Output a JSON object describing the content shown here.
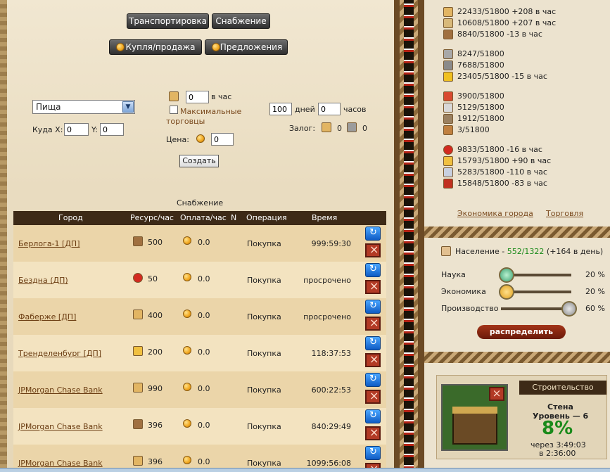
{
  "tabs": {
    "transport": "Транспортировка",
    "supply": "Снабжение",
    "trade": "Купля/продажа",
    "offers": "Предложения"
  },
  "form": {
    "resource_selected": "Пища",
    "per_hour_value": "0",
    "per_hour_label": "в час",
    "max_trade_label_1": "Максимальные",
    "max_trade_label_2": "торговцы",
    "days_value": "100",
    "days_label": "дней",
    "hours_value": "0",
    "hours_label": "часов",
    "dest_label": "Куда X:",
    "x_value": "0",
    "y_label": "Y:",
    "y_value": "0",
    "price_label": "Цена:",
    "price_value": "0",
    "collateral_label": "Залог:",
    "collateral_1": "0",
    "collateral_2": "0",
    "create_button": "Создать"
  },
  "table": {
    "title": "Снабжение",
    "headers": {
      "city": "Город",
      "resource": "Ресурс/час",
      "pay": "Оплата/час",
      "n": "N",
      "operation": "Операция",
      "time": "Время"
    },
    "rows": [
      {
        "city": "Берлога-1 [ДП]",
        "res_icon": "wood-icon",
        "res": "500",
        "pay": "0.0",
        "op": "Покупка",
        "time": "999:59:30"
      },
      {
        "city": "Бездна (ДП)",
        "res_icon": "apple-icon",
        "res": "50",
        "pay": "0.0",
        "op": "Покупка",
        "time": "просрочено"
      },
      {
        "city": "Фаберже [ДП]",
        "res_icon": "food-icon",
        "res": "400",
        "pay": "0.0",
        "op": "Покупка",
        "time": "просрочено"
      },
      {
        "city": "Тренделенбург [ДП]",
        "res_icon": "horn-icon",
        "res": "200",
        "pay": "0.0",
        "op": "Покупка",
        "time": "118:37:53"
      },
      {
        "city": "JPMorgan Chase Bank",
        "res_icon": "food-icon",
        "res": "990",
        "pay": "0.0",
        "op": "Покупка",
        "time": "600:22:53"
      },
      {
        "city": "JPMorgan Chase Bank",
        "res_icon": "wood-icon",
        "res": "396",
        "pay": "0.0",
        "op": "Покупка",
        "time": "840:29:49"
      },
      {
        "city": "JPMorgan Chase Bank",
        "res_icon": "food-icon",
        "res": "396",
        "pay": "0.0",
        "op": "Покупка",
        "time": "1099:56:08"
      }
    ]
  },
  "resources": [
    {
      "icon": "food-icon",
      "text": "22433/51800 +208 в час"
    },
    {
      "icon": "grain-icon",
      "text": "10608/51800 +207 в час"
    },
    {
      "icon": "wood-icon",
      "text": "8840/51800 -13 в час"
    },
    {
      "icon": "stone-icon",
      "text": "8247/51800"
    },
    {
      "icon": "tool-icon",
      "text": "7688/51800"
    },
    {
      "icon": "gold-icon",
      "text": "23405/51800 -15 в час"
    },
    {
      "icon": "potion-icon",
      "text": "3900/51800"
    },
    {
      "icon": "cloth-icon",
      "text": "5129/51800"
    },
    {
      "icon": "sword-icon",
      "text": "1912/51800"
    },
    {
      "icon": "horse-icon",
      "text": "3/51800"
    },
    {
      "icon": "apple-icon",
      "text": "9833/51800 -16 в час"
    },
    {
      "icon": "horn-icon",
      "text": "15793/51800 +90 в час"
    },
    {
      "icon": "salt-icon",
      "text": "5283/51800 -110 в час"
    },
    {
      "icon": "meat-icon",
      "text": "15848/51800 -83 в час"
    }
  ],
  "links": {
    "economy": "Экономика города",
    "trade": "Торговля"
  },
  "population": {
    "label": "Население -",
    "value": "552/1322",
    "growth": "(+164 в день)"
  },
  "sliders": [
    {
      "label": "Наука",
      "value": "20",
      "unit": "%",
      "level": 0.05
    },
    {
      "label": "Экономика",
      "value": "20",
      "unit": "%",
      "level": 0.05
    },
    {
      "label": "Производство",
      "value": "60",
      "unit": "%",
      "level": 0.95
    }
  ],
  "distribute_button": "распределить",
  "construction": {
    "title": "Строительство",
    "building": "Стена",
    "level": "Уровень — 6",
    "percent": "8%",
    "remaining": "через 3:49:03",
    "finish": "в 2:36:00"
  },
  "colors": {
    "panel_dark": "#3d2a17",
    "progress_green": "#1a8a1a",
    "link": "#6b3d12"
  }
}
